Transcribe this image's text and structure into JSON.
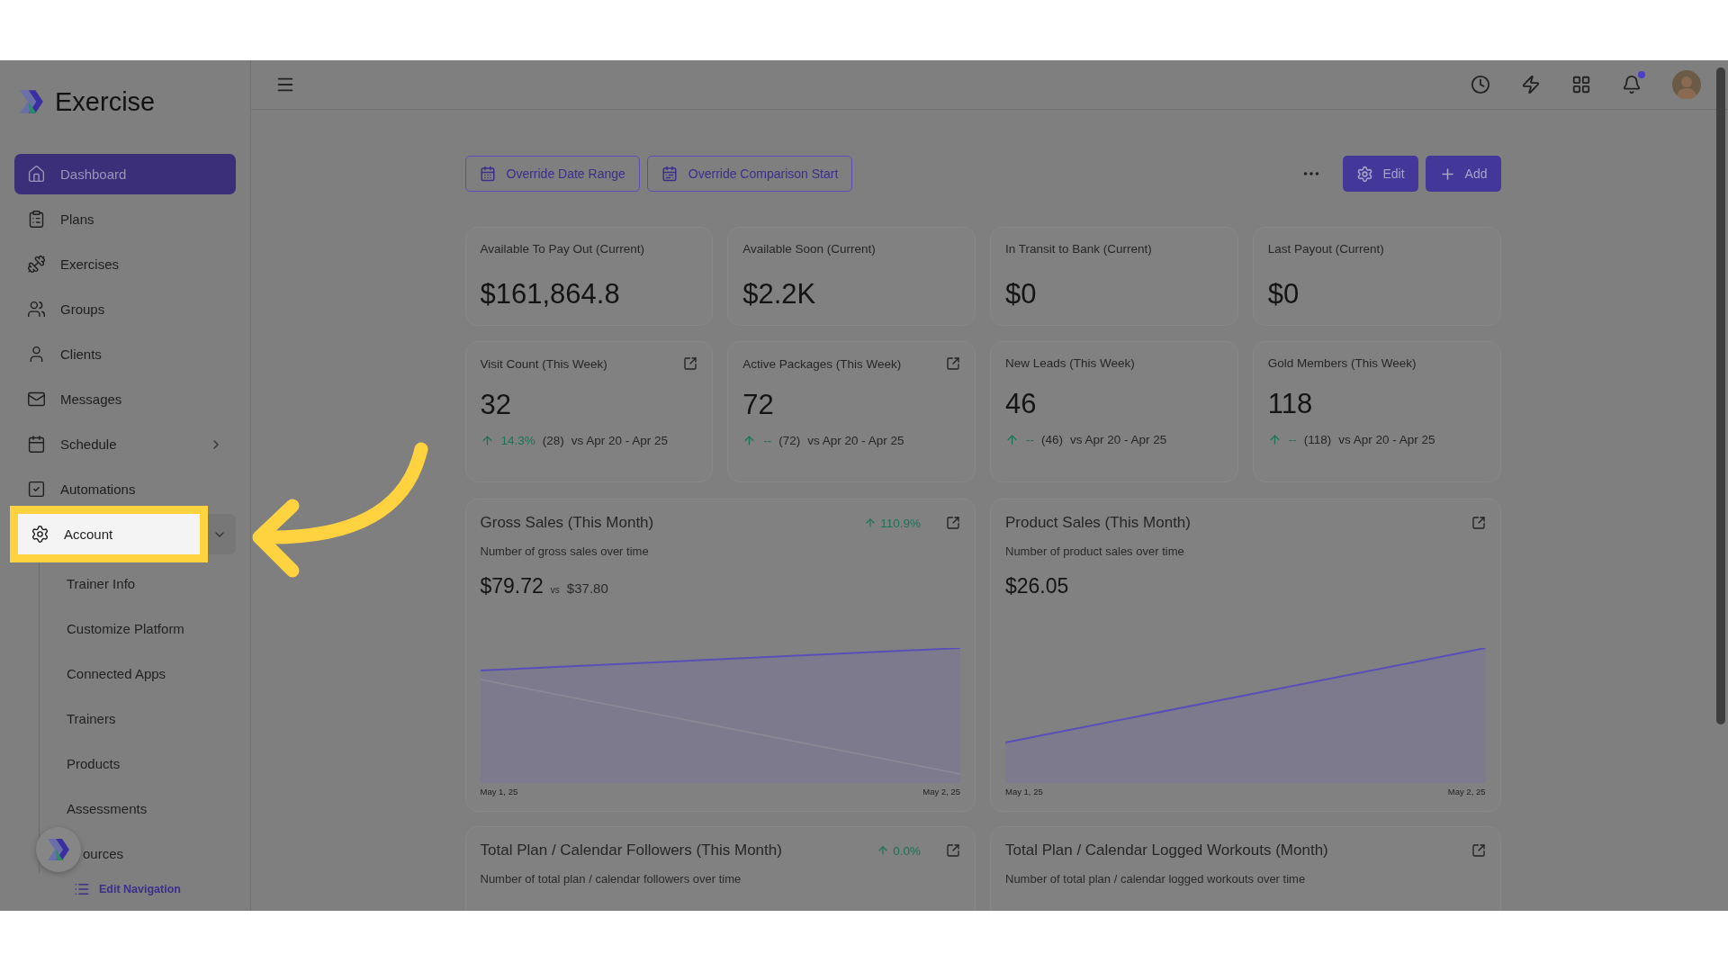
{
  "sidebar": {
    "brand": "Exercise",
    "items": [
      {
        "label": "Dashboard",
        "selected": true,
        "highlighted": false
      },
      {
        "label": "Plans",
        "selected": false,
        "highlighted": false
      },
      {
        "label": "Exercises",
        "selected": false,
        "highlighted": false
      },
      {
        "label": "Groups",
        "selected": false,
        "highlighted": false
      },
      {
        "label": "Clients",
        "selected": false,
        "highlighted": false
      },
      {
        "label": "Messages",
        "selected": false,
        "highlighted": false
      },
      {
        "label": "Schedule",
        "selected": false,
        "highlighted": false,
        "expanded": false
      },
      {
        "label": "Automations",
        "selected": false,
        "highlighted": false
      },
      {
        "label": "Account",
        "selected": false,
        "highlighted": true,
        "expanded": true,
        "children": [
          {
            "label": "Trainer Info"
          },
          {
            "label": "Customize Platform"
          },
          {
            "label": "Connected Apps"
          },
          {
            "label": "Trainers"
          },
          {
            "label": "Products"
          },
          {
            "label": "Assessments"
          },
          {
            "label": "ources"
          }
        ]
      }
    ],
    "edit_navigation": "Edit Navigation"
  },
  "topbar": {
    "notifications_unread": true
  },
  "toolbar": {
    "filters": [
      {
        "label": "Override Date Range"
      },
      {
        "label": "Override Comparison Start"
      }
    ],
    "actions": [
      {
        "label": "Edit"
      },
      {
        "label": "Add"
      }
    ]
  },
  "stat_cards": [
    {
      "title": "Available To Pay Out (Current)",
      "value": "$161,864.8"
    },
    {
      "title": "Available Soon (Current)",
      "value": "$2.2K"
    },
    {
      "title": "In Transit to Bank (Current)",
      "value": "$0"
    },
    {
      "title": "Last Payout (Current)",
      "value": "$0"
    }
  ],
  "metric_cards": [
    {
      "title": "Visit Count (This Week)",
      "value": "32",
      "change": "14.3%",
      "count": "(28)",
      "comparison": "vs Apr 20 - Apr 25",
      "external_link": true
    },
    {
      "title": "Active Packages (This Week)",
      "value": "72",
      "change": "--",
      "count": "(72)",
      "comparison": "vs Apr 20 - Apr 25",
      "external_link": true
    },
    {
      "title": "New Leads (This Week)",
      "value": "46",
      "change": "--",
      "count": "(46)",
      "comparison": "vs Apr 20 - Apr 25",
      "external_link": false
    },
    {
      "title": "Gold Members (This Week)",
      "value": "118",
      "change": "--",
      "count": "(118)",
      "comparison": "vs Apr 20 - Apr 25",
      "external_link": false
    }
  ],
  "chart_cards": [
    {
      "title": "Gross Sales (This Month)",
      "change": "110.9%",
      "subtitle": "Number of gross sales over time",
      "value": "$79.72",
      "vs": "vs",
      "compare_value": "$37.80",
      "x_start": "May 1, 25",
      "x_end": "May 2, 25"
    },
    {
      "title": "Product Sales (This Month)",
      "subtitle": "Number of product sales over time",
      "value": "$26.05",
      "x_start": "May 1, 25",
      "x_end": "May 2, 25"
    },
    {
      "title": "Total Plan / Calendar Followers (This Month)",
      "change": "0.0%",
      "subtitle": "Number of total plan / calendar followers over time"
    },
    {
      "title": "Total Plan / Calendar Logged Workouts (Month)",
      "subtitle": "Number of total plan / calendar logged workouts over time"
    }
  ]
}
